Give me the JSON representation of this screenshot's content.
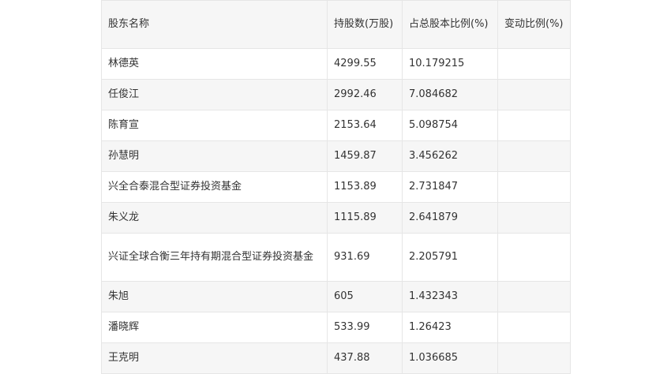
{
  "table": {
    "headers": {
      "name": "股东名称",
      "shares": "持股数(万股)",
      "ratio": "占总股本比例(%)",
      "change": "变动比例(%)"
    },
    "rows": [
      {
        "name": "林德英",
        "shares": "4299.55",
        "ratio": "10.179215",
        "change": ""
      },
      {
        "name": "任俊江",
        "shares": "2992.46",
        "ratio": "7.084682",
        "change": ""
      },
      {
        "name": "陈育宣",
        "shares": "2153.64",
        "ratio": "5.098754",
        "change": ""
      },
      {
        "name": "孙慧明",
        "shares": "1459.87",
        "ratio": "3.456262",
        "change": ""
      },
      {
        "name": "兴全合泰混合型证券投资基金",
        "shares": "1153.89",
        "ratio": "2.731847",
        "change": ""
      },
      {
        "name": "朱义龙",
        "shares": "1115.89",
        "ratio": "2.641879",
        "change": ""
      },
      {
        "name": "兴证全球合衡三年持有期混合型证券投资基金",
        "shares": "931.69",
        "ratio": "2.205791",
        "change": ""
      },
      {
        "name": "朱旭",
        "shares": "605",
        "ratio": "1.432343",
        "change": ""
      },
      {
        "name": "潘晓辉",
        "shares": "533.99",
        "ratio": "1.26423",
        "change": ""
      },
      {
        "name": "王克明",
        "shares": "437.88",
        "ratio": "1.036685",
        "change": ""
      }
    ]
  }
}
